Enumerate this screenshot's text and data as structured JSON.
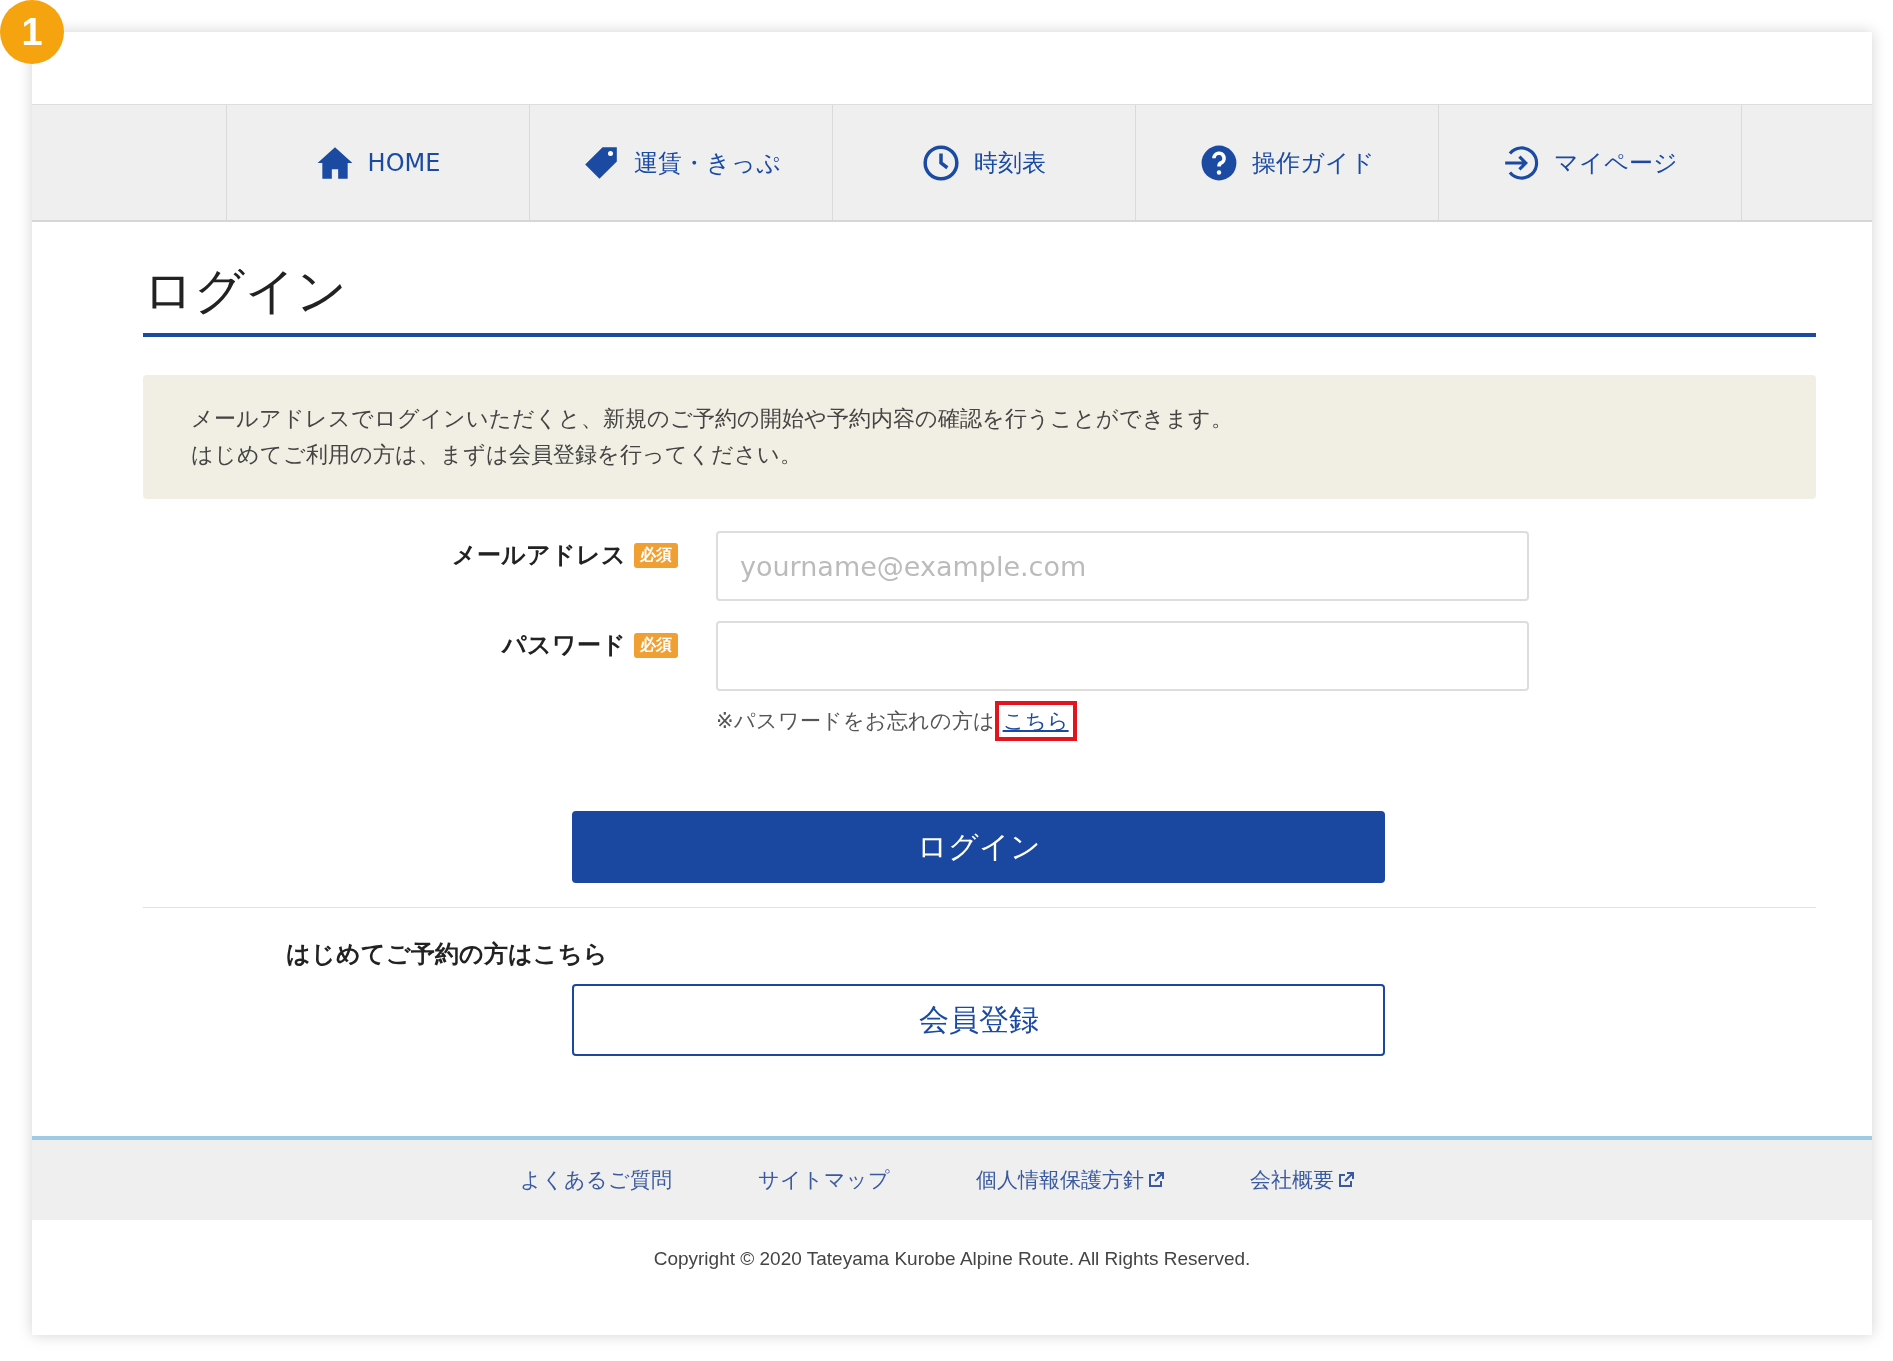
{
  "step_badge": "1",
  "nav": [
    {
      "kind": "home",
      "label": "HOME"
    },
    {
      "kind": "fares",
      "label": "運賃・きっぷ"
    },
    {
      "kind": "timetable",
      "label": "時刻表"
    },
    {
      "kind": "guide",
      "label": "操作ガイド"
    },
    {
      "kind": "mypage",
      "label": "マイページ"
    }
  ],
  "page_title": "ログイン",
  "notice": [
    "メールアドレスでログインいただくと、新規のご予約の開始や予約内容の確認を行うことができます。",
    "はじめてご利用の方は、まずは会員登録を行ってください。"
  ],
  "fields": [
    {
      "label": "メールアドレス",
      "required_badge": "必須",
      "placeholder": "yourname@example.com"
    },
    {
      "label": "パスワード",
      "required_badge": "必須"
    }
  ],
  "forgot": {
    "text": "※パスワードをお忘れの方は",
    "link": "こちら",
    "highlighted": true
  },
  "login_button": "ログイン",
  "first_time": {
    "label": "はじめてご予約の方はこちら",
    "button": "会員登録"
  },
  "footer_links": [
    {
      "label": "よくあるご質問",
      "external": false
    },
    {
      "label": "サイトマップ",
      "external": false
    },
    {
      "label": "個人情報保護方針",
      "external": true
    },
    {
      "label": "会社概要",
      "external": true
    }
  ],
  "copyright": "Copyright © 2020 Tateyama Kurobe Alpine Route. All Rights Reserved."
}
